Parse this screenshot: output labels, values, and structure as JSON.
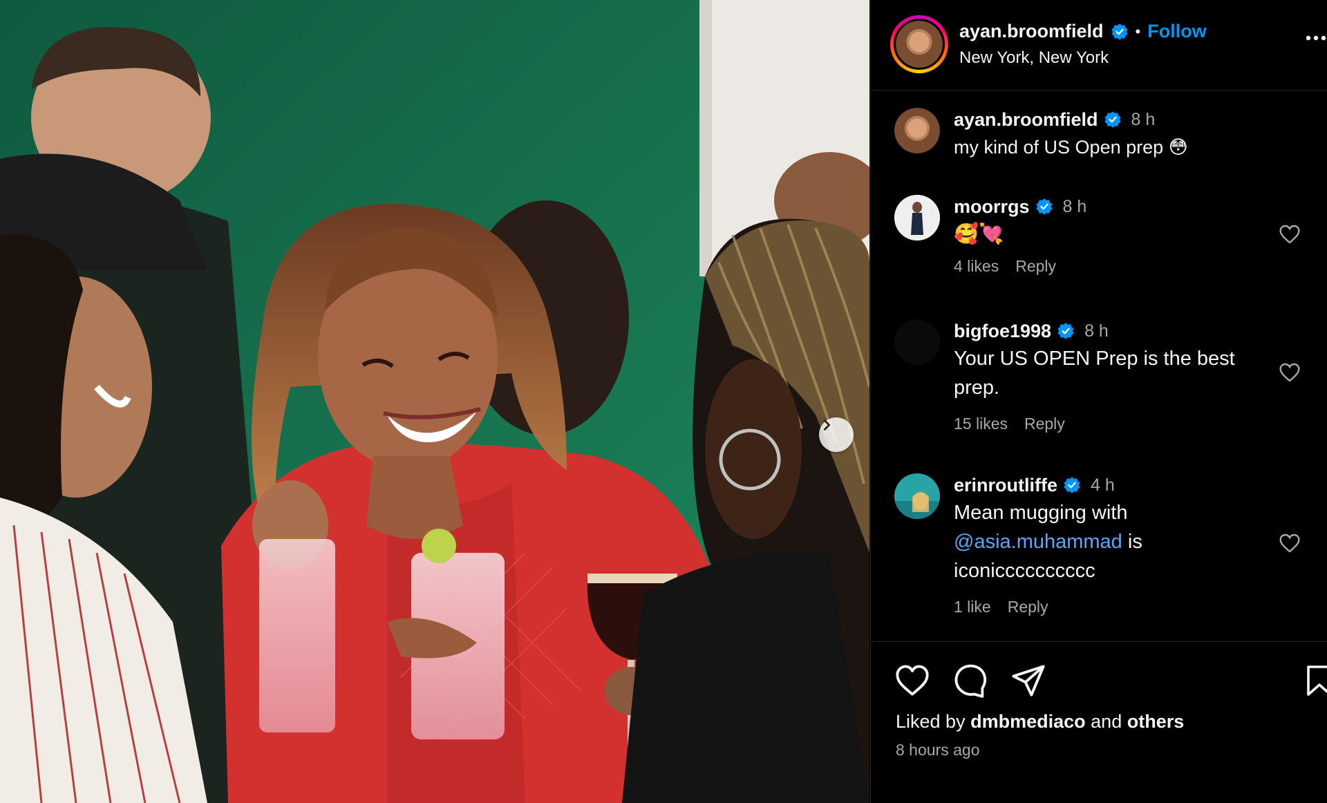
{
  "post": {
    "author": "ayan.broomfield",
    "separator": "•",
    "follow_label": "Follow",
    "location": "New York, New York"
  },
  "comments": [
    {
      "username": "ayan.broomfield",
      "time": "8 h",
      "text": "my kind of US Open prep 😳",
      "verified": true,
      "is_caption": true
    },
    {
      "username": "moorrgs",
      "time": "8 h",
      "text": "🥰💘",
      "likes": "4 likes",
      "reply": "Reply",
      "verified": true
    },
    {
      "username": "bigfoe1998",
      "time": "8 h",
      "text": "Your US OPEN Prep is the best prep.",
      "likes": "15 likes",
      "reply": "Reply",
      "verified": true
    },
    {
      "username": "erinroutliffe",
      "time": "4 h",
      "text_before": "Mean mugging with",
      "mention": "@asia.muhammad",
      "text_after": "is iconicccccccccc",
      "likes": "1 like",
      "reply": "Reply",
      "verified": true
    }
  ],
  "footer": {
    "liked_prefix": "Liked by",
    "liked_user": "dmbmediaco",
    "liked_and": "and",
    "liked_others": "others",
    "post_time": "8 hours ago"
  },
  "icons": {
    "verified": "verified-badge-icon",
    "like": "heart-icon",
    "comment": "comment-icon",
    "share": "paper-plane-icon",
    "save": "bookmark-icon",
    "more": "more-options-icon",
    "next": "chevron-right-icon"
  },
  "colors": {
    "background": "#000000",
    "link_blue": "#0095f6",
    "verified_blue": "#0095f6",
    "muted_text": "#a8a8a8"
  }
}
